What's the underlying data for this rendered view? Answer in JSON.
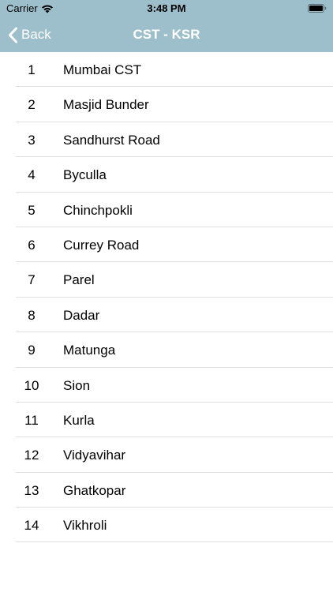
{
  "status_bar": {
    "carrier": "Carrier",
    "time": "3:48 PM"
  },
  "nav": {
    "back_label": "Back",
    "title": "CST - KSR"
  },
  "colors": {
    "header_background": "#9DBFCB",
    "header_text": "#ffffff",
    "separator": "#e0e0e0"
  },
  "stations": [
    {
      "number": "1",
      "name": "Mumbai CST"
    },
    {
      "number": "2",
      "name": "Masjid Bunder"
    },
    {
      "number": "3",
      "name": "Sandhurst Road"
    },
    {
      "number": "4",
      "name": "Byculla"
    },
    {
      "number": "5",
      "name": "Chinchpokli"
    },
    {
      "number": "6",
      "name": "Currey Road"
    },
    {
      "number": "7",
      "name": "Parel"
    },
    {
      "number": "8",
      "name": "Dadar"
    },
    {
      "number": "9",
      "name": "Matunga"
    },
    {
      "number": "10",
      "name": "Sion"
    },
    {
      "number": "11",
      "name": "Kurla"
    },
    {
      "number": "12",
      "name": "Vidyavihar"
    },
    {
      "number": "13",
      "name": "Ghatkopar"
    },
    {
      "number": "14",
      "name": "Vikhroli"
    }
  ]
}
